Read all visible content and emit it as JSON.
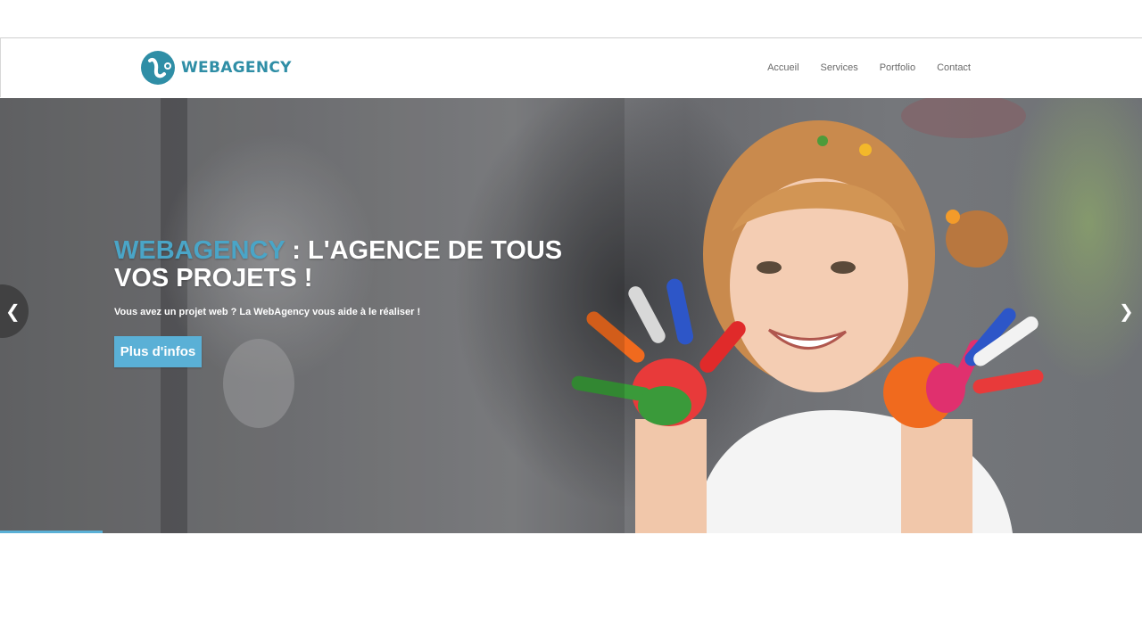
{
  "header": {
    "logo_text": "WEBAGENCY",
    "nav": [
      "Accueil",
      "Services",
      "Portfolio",
      "Contact"
    ]
  },
  "hero": {
    "title_brand": "WEBAGENCY",
    "title_rest": " : L'AGENCE DE TOUS VOS PROJETS !",
    "subtitle": "Vous avez un projet web ? La WebAgency vous aide à le réaliser !",
    "button_label": "Plus d'infos",
    "prev_icon": "chevron-left-icon",
    "next_icon": "chevron-right-icon",
    "slide_progress": 0.09
  },
  "colors": {
    "brand": "#2f8ea6",
    "accent": "#5ab0d6",
    "nav_text": "#6a6a6a"
  }
}
